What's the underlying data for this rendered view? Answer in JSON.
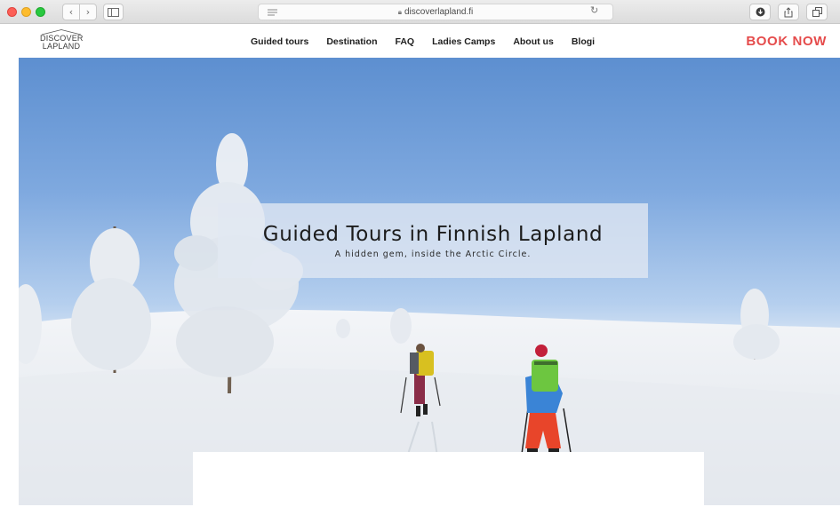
{
  "browser": {
    "url": "discoverlapland.fi",
    "nav_back": "‹",
    "nav_forward": "›",
    "icons": [
      "sidebar-icon",
      "reader-icon",
      "lock-icon",
      "reload-icon",
      "download-icon",
      "share-icon",
      "tabs-icon"
    ]
  },
  "site": {
    "logo_line1": "DISCOVER",
    "logo_line2": "LAPLAND",
    "menu": [
      "Guided tours",
      "Destination",
      "FAQ",
      "Ladies Camps",
      "About us",
      "Blogi"
    ],
    "book_now": "BOOK NOW",
    "accent_color": "#e54b4b"
  },
  "hero": {
    "title": "Guided Tours in Finnish Lapland",
    "subtitle": "A hidden gem, inside the Arctic Circle."
  }
}
